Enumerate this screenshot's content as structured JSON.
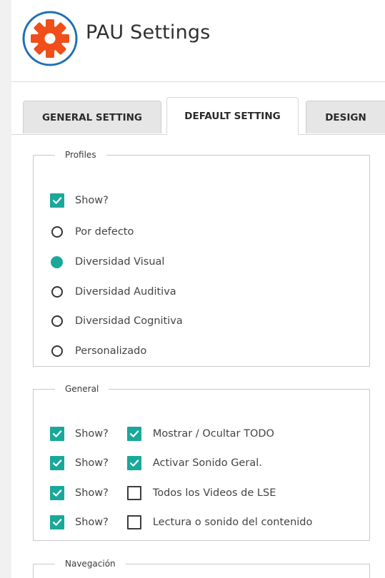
{
  "app": {
    "title": "PAU Settings",
    "logo_icon": "gear-icon",
    "brand_color": "#1f6fb5",
    "accent_color": "#1aa89a",
    "logo_gear_color": "#f04e1a"
  },
  "tabs": [
    {
      "label": "GENERAL SETTING",
      "active": false
    },
    {
      "label": "DEFAULT SETTING",
      "active": true
    },
    {
      "label": "DESIGN",
      "active": false
    }
  ],
  "profiles": {
    "legend": "Profiles",
    "show_label": "Show?",
    "show_checked": true,
    "options": [
      {
        "label": "Por defecto",
        "selected": false
      },
      {
        "label": "Diversidad Visual",
        "selected": true
      },
      {
        "label": "Diversidad Auditiva",
        "selected": false
      },
      {
        "label": "Diversidad Cognitiva",
        "selected": false
      },
      {
        "label": "Personalizado",
        "selected": false
      }
    ]
  },
  "general": {
    "legend": "General",
    "rows": [
      {
        "show_label": "Show?",
        "show_checked": true,
        "label": "Mostrar / Ocultar TODO",
        "checked": true
      },
      {
        "show_label": "Show?",
        "show_checked": true,
        "label": "Activar Sonido Geral.",
        "checked": true
      },
      {
        "show_label": "Show?",
        "show_checked": true,
        "label": "Todos los Videos de LSE",
        "checked": false
      },
      {
        "show_label": "Show?",
        "show_checked": true,
        "label": "Lectura o sonido del contenido",
        "checked": false
      }
    ]
  },
  "navegacion": {
    "legend": "Navegación"
  }
}
